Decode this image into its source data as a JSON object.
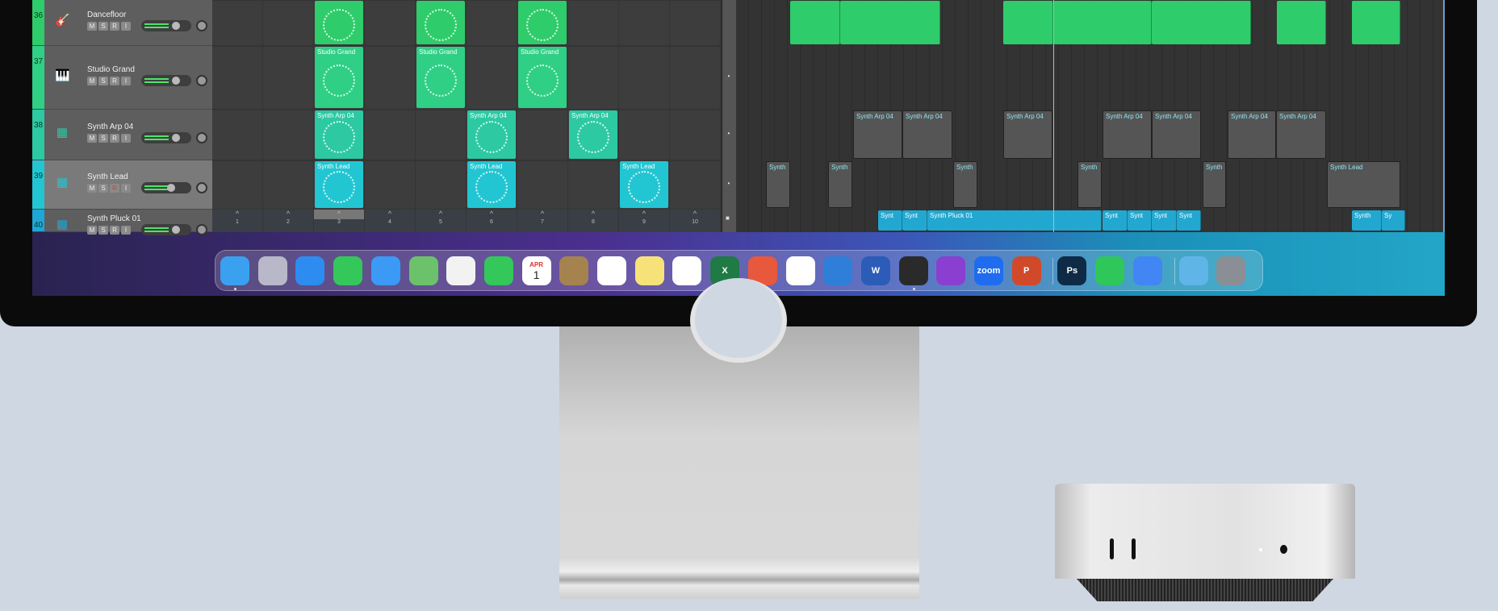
{
  "tracks": [
    {
      "number": "36",
      "name": "Dancefloor",
      "icon": "guitar-icon",
      "color": "#2ecc6a",
      "selected": false
    },
    {
      "number": "37",
      "name": "Studio Grand",
      "icon": "piano-icon",
      "color": "#2fcf86",
      "selected": false
    },
    {
      "number": "38",
      "name": "Synth Arp 04",
      "icon": "keyboard-icon",
      "color": "#2cc9a3",
      "selected": false
    },
    {
      "number": "39",
      "name": "Synth Lead",
      "icon": "keyboard-icon",
      "color": "#22c6d2",
      "selected": true
    },
    {
      "number": "40",
      "name": "Synth Pluck 01",
      "icon": "keyboard-icon",
      "color": "#1ea6d6",
      "selected": false
    }
  ],
  "track_buttons": [
    "M",
    "S",
    "R",
    "I"
  ],
  "clip_labels": {
    "37": "Studio Grand",
    "38": "Synth Arp 04",
    "39": "Synth Lead"
  },
  "scenes": [
    "1",
    "2",
    "3",
    "4",
    "5",
    "6",
    "7",
    "8",
    "9",
    "10"
  ],
  "selected_scene": "3",
  "region_labels": {
    "arp": "Synth Arp 04",
    "synth": "Synth",
    "lead": "Synth Lead",
    "synt": "Synt",
    "pluck": "Synth Pluck 01",
    "sy": "Sy"
  },
  "dock": [
    {
      "name": "Finder",
      "color": "#3aa0f0",
      "running": true
    },
    {
      "name": "Launchpad",
      "color": "#b8b8c8"
    },
    {
      "name": "Safari",
      "color": "#2d8cf0"
    },
    {
      "name": "Messages",
      "color": "#34c759"
    },
    {
      "name": "Mail",
      "color": "#3a9af5"
    },
    {
      "name": "Maps",
      "color": "#6cc26a"
    },
    {
      "name": "Photos",
      "color": "#f2f2f2"
    },
    {
      "name": "FaceTime",
      "color": "#34c759"
    },
    {
      "name": "Calendar",
      "color": "#ffffff",
      "label": "APR",
      "sub": "1"
    },
    {
      "name": "Contacts",
      "color": "#a5834f"
    },
    {
      "name": "Reminders",
      "color": "#ffffff"
    },
    {
      "name": "Notes",
      "color": "#f7e27a"
    },
    {
      "name": "Slack",
      "color": "#ffffff"
    },
    {
      "name": "Excel",
      "color": "#1f7a45",
      "label": "X"
    },
    {
      "name": "Red App",
      "color": "#e8583c"
    },
    {
      "name": "Chrome",
      "color": "#ffffff"
    },
    {
      "name": "Xcode",
      "color": "#2f7fd8"
    },
    {
      "name": "Word",
      "color": "#2b5cb8",
      "label": "W"
    },
    {
      "name": "Logic Pro",
      "color": "#2a2a2a",
      "running": true
    },
    {
      "name": "Affinity Photo",
      "color": "#8a3fd0"
    },
    {
      "name": "Zoom",
      "color": "#1f6cf0",
      "label": "zoom"
    },
    {
      "name": "PowerPoint",
      "color": "#d04a2a",
      "label": "P"
    },
    {
      "sep": true
    },
    {
      "name": "Photoshop",
      "color": "#0f2a44",
      "label": "Ps"
    },
    {
      "name": "WhatsApp",
      "color": "#2fc75a"
    },
    {
      "name": "Google Docs",
      "color": "#4285f4"
    },
    {
      "sep": true
    },
    {
      "name": "Downloads",
      "color": "#5fb4e8"
    },
    {
      "name": "Trash",
      "color": "#8a8f96"
    }
  ]
}
